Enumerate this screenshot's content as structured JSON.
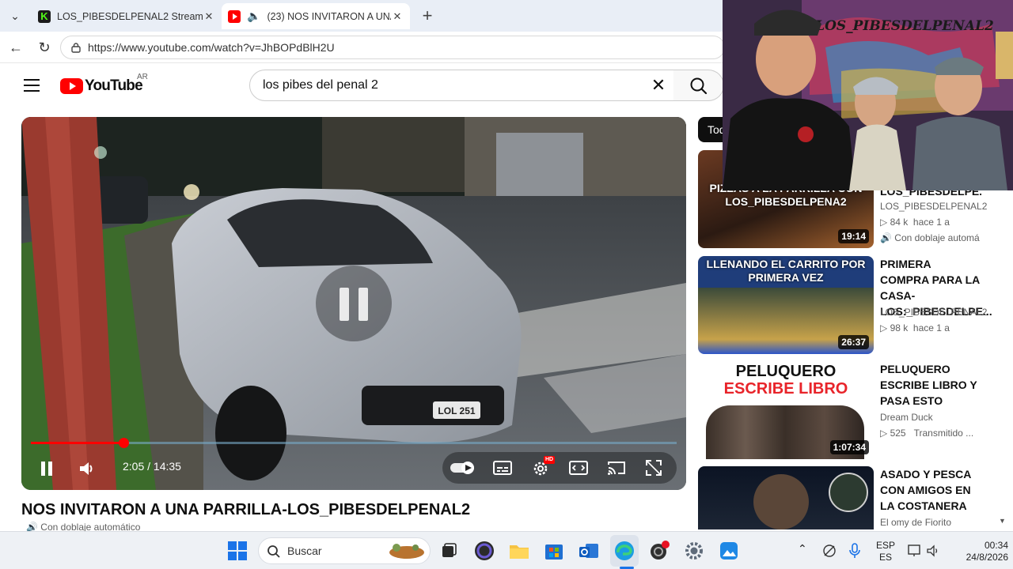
{
  "browser": {
    "tabs": [
      {
        "title": "LOS_PIBESDELPENAL2 Stream - Wa",
        "favicon": "kick-icon",
        "active": false
      },
      {
        "title": "(23) NOS INVITARON A UNA P",
        "favicon": "youtube-icon",
        "active": true,
        "audio": true
      }
    ],
    "url": "https://www.youtube.com/watch?v=JhBOPdBlH2U"
  },
  "youtube": {
    "logo": "YouTube",
    "country": "AR",
    "search_query": "los pibes del penal 2",
    "player": {
      "current_time": "2:05",
      "duration": "14:35",
      "time_display": "2:05 / 14:35",
      "progress": 0.143,
      "hd_badge": "HD",
      "plate": "LOL 251"
    },
    "video_title": "NOS INVITARON A UNA PARRILLA-LOS_PIBESDELPENAL2",
    "video_subtitle": "Con doblaje automático",
    "chip": "Todos",
    "recommendations": [
      {
        "thumb_text": "PIZZAS A LA PARRILLA CON LOS_PIBESDELPENA2",
        "duration": "19:14",
        "title": "LOS_PIBESDELPE...",
        "channel": "LOS_PIBESDELPENAL2",
        "views": "84 k",
        "age": "hace 1 a",
        "badge": "Con doblaje automá"
      },
      {
        "thumb_text": "LLENANDO EL CARRITO POR PRIMERA VEZ",
        "duration": "26:37",
        "title": "PRIMERA COMPRA PARA LA CASA-LOS:_PIBESDELPE...",
        "channel": "LOS_PIBESDELPENAL2",
        "views": "98 k",
        "age": "hace 1 a"
      },
      {
        "thumb_text_1": "PELUQUERO",
        "thumb_text_2": "ESCRIBE LIBRO",
        "duration": "1:07:34",
        "title": "PELUQUERO ESCRIBE LIBRO Y PASA ESTO",
        "channel": "Dream Duck",
        "views": "525",
        "age": "Transmitido ..."
      },
      {
        "title": "ASADO Y PESCA CON AMIGOS EN LA COSTANERA",
        "channel": "El omy de Fiorito"
      }
    ]
  },
  "webcam": {
    "wall_text": "LOS_PIBESDELPENAL2"
  },
  "taskbar": {
    "search_placeholder": "Buscar",
    "lang_top": "ESP",
    "lang_bottom": "ES",
    "time": "00:34",
    "date": "24/8/2026"
  },
  "colors": {
    "youtube_red": "#ff0000",
    "progress_red": "#ff0000",
    "taskbar_bg": "#eef1f5"
  }
}
